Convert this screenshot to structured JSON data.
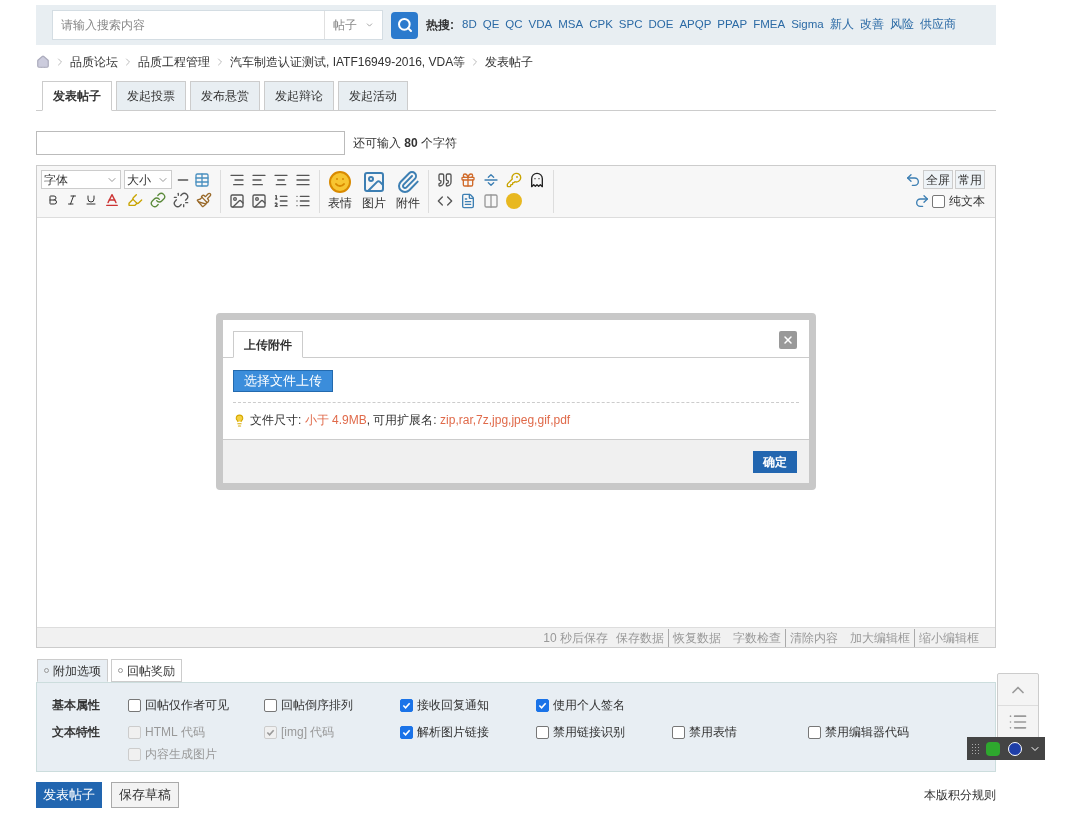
{
  "search": {
    "placeholder": "请输入搜索内容",
    "scope": "帖子",
    "hot_label": "热搜:",
    "hot_links": [
      "8D",
      "QE",
      "QC",
      "VDA",
      "MSA",
      "CPK",
      "SPC",
      "DOE",
      "APQP",
      "PPAP",
      "FMEA",
      "Sigma",
      "新人",
      "改善",
      "风险",
      "供应商"
    ]
  },
  "breadcrumb": [
    "品质论坛",
    "品质工程管理",
    "汽车制造认证测试, IATF16949-2016, VDA等",
    "发表帖子"
  ],
  "tabs": [
    {
      "label": "发表帖子",
      "selected": true
    },
    {
      "label": "发起投票",
      "selected": false
    },
    {
      "label": "发布悬赏",
      "selected": false
    },
    {
      "label": "发起辩论",
      "selected": false
    },
    {
      "label": "发起活动",
      "selected": false
    }
  ],
  "title_counter": "还可输入 **80** 个字符",
  "editor": {
    "font_select": "字体",
    "size_select": "大小",
    "big_buttons": [
      "表情",
      "图片",
      "附件"
    ],
    "right_buttons": [
      "全屏",
      "常用"
    ],
    "plain_text": {
      "label": "纯文本",
      "checked": false
    },
    "autosave": "10 秒后保存",
    "status_groups": [
      [
        "保存数据",
        "恢复数据"
      ],
      [
        "字数检查",
        "清除内容"
      ],
      [
        "加大编辑框",
        "缩小编辑框"
      ]
    ]
  },
  "dialog": {
    "tab": "上传附件",
    "upload_button": "选择文件上传",
    "size_label": "文件尺寸:",
    "size_value": "小于 4.9MB",
    "ext_label": ", 可用扩展名:",
    "ext_value": "zip,rar,7z,jpg,jpeg,gif,pdf",
    "ok_button": "确定"
  },
  "options": {
    "tabs": [
      {
        "label": "附加选项",
        "selected": true
      },
      {
        "label": "回帖奖励",
        "selected": false
      }
    ],
    "rows": [
      {
        "label": "基本属性",
        "items": [
          {
            "label": "回帖仅作者可见",
            "checked": false,
            "disabled": false
          },
          {
            "label": "回帖倒序排列",
            "checked": false,
            "disabled": false
          },
          {
            "label": "接收回复通知",
            "checked": true,
            "disabled": false
          },
          {
            "label": "使用个人签名",
            "checked": true,
            "disabled": false
          }
        ]
      },
      {
        "label": "文本特性",
        "items": [
          {
            "label": "HTML 代码",
            "checked": false,
            "disabled": true
          },
          {
            "label": "[img] 代码",
            "checked": true,
            "disabled": true
          },
          {
            "label": "解析图片链接",
            "checked": true,
            "disabled": false
          },
          {
            "label": "禁用链接识别",
            "checked": false,
            "disabled": false
          },
          {
            "label": "禁用表情",
            "checked": false,
            "disabled": false
          },
          {
            "label": "禁用编辑器代码",
            "checked": false,
            "disabled": false
          },
          {
            "label": "内容生成图片",
            "checked": false,
            "disabled": true
          }
        ]
      }
    ]
  },
  "actions": {
    "post": "发表帖子",
    "draft": "保存草稿"
  },
  "rules_link": "本版积分规则"
}
